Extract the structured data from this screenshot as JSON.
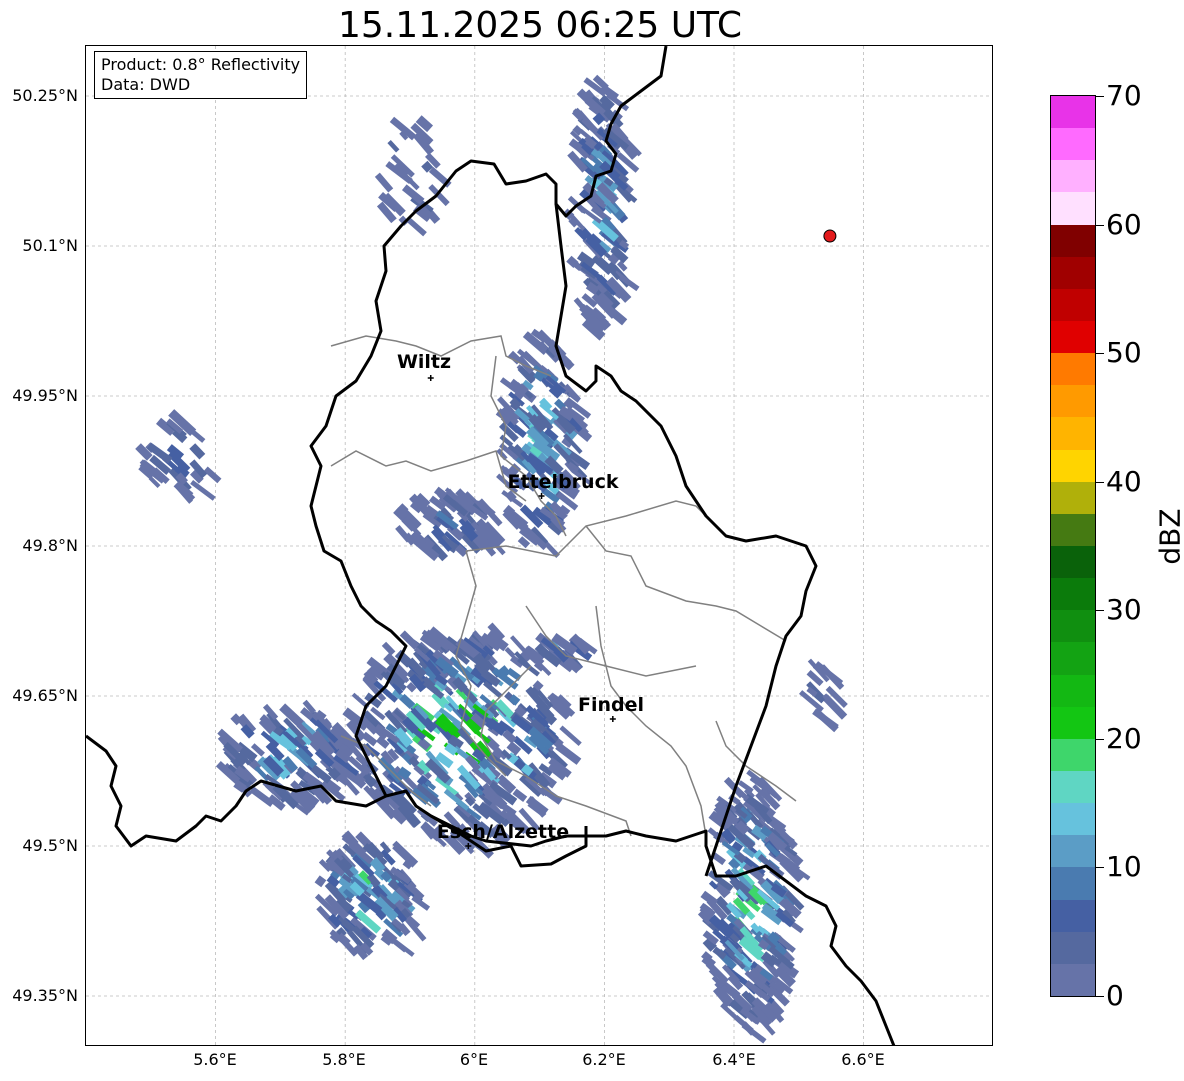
{
  "title": "15.11.2025 06:25 UTC",
  "info_box": {
    "product": "Product: 0.8° Reflectivity",
    "data": "Data: DWD"
  },
  "axes": {
    "lat_ticks": [
      "50.25°N",
      "50.1°N",
      "49.95°N",
      "49.8°N",
      "49.65°N",
      "49.5°N",
      "49.35°N"
    ],
    "lon_ticks": [
      "5.6°E",
      "5.8°E",
      "6°E",
      "6.2°E",
      "6.4°E",
      "6.6°E"
    ]
  },
  "cities": [
    {
      "name": "Wiltz",
      "lat": 49.968,
      "lon": 5.932
    },
    {
      "name": "Ettelbruck",
      "lat": 49.85,
      "lon": 6.103
    },
    {
      "name": "Findel",
      "lat": 49.627,
      "lon": 6.213
    },
    {
      "name": "Esch/Alzette",
      "lat": 49.5,
      "lon": 5.99
    }
  ],
  "radar_site": {
    "lat": 50.11,
    "lon": 6.548,
    "color": "#e31a1c"
  },
  "colorbar": {
    "label": "dBZ",
    "min": 0,
    "max": 70,
    "tick_labels": [
      "70",
      "60",
      "50",
      "40",
      "30",
      "20",
      "10",
      "0"
    ],
    "colors": [
      "#6673a8",
      "#55699f",
      "#4560a3",
      "#4a7bb0",
      "#5b9dc6",
      "#66c2dd",
      "#5fd6c3",
      "#3ed66b",
      "#13c613",
      "#13b813",
      "#13a313",
      "#108f10",
      "#0b7b0b",
      "#0a620a",
      "#457a12",
      "#b0b00a",
      "#ffd400",
      "#ffb400",
      "#ff9a00",
      "#ff7a00",
      "#e00000",
      "#c00000",
      "#a00000",
      "#800000",
      "#ffe0ff",
      "#ffb0ff",
      "#ff6aff",
      "#e833e8"
    ]
  }
}
